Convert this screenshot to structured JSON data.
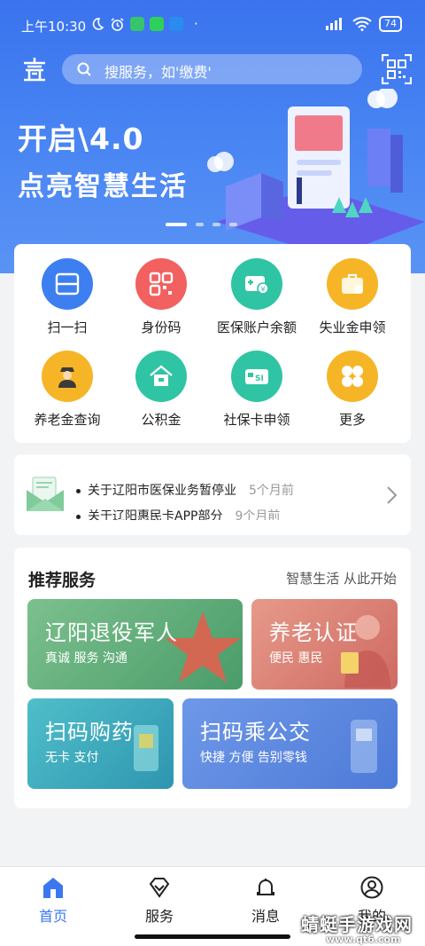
{
  "status_bar": {
    "time": "上午10:30",
    "battery": "74"
  },
  "search": {
    "placeholder": "搜服务，如'缴费'"
  },
  "banner": {
    "line1": "开启\\4.0",
    "line2": "点亮智慧生活"
  },
  "grid": [
    {
      "label": "扫一扫",
      "icon": "scan-icon",
      "color": "#3d7ff0"
    },
    {
      "label": "身份码",
      "icon": "id-qr-icon",
      "color": "#f26060"
    },
    {
      "label": "医保账户余额",
      "icon": "medical-card-icon",
      "color": "#2fc4a4"
    },
    {
      "label": "失业金申领",
      "icon": "unemployment-box-icon",
      "color": "#f6b526"
    },
    {
      "label": "养老金查询",
      "icon": "elder-person-icon",
      "color": "#f6b526"
    },
    {
      "label": "公积金",
      "icon": "house-icon",
      "color": "#2fc4a4"
    },
    {
      "label": "社保卡申领",
      "icon": "si-card-icon",
      "color": "#2fc4a4"
    },
    {
      "label": "更多",
      "icon": "more-icon",
      "color": "#f6b526"
    }
  ],
  "notices": [
    {
      "text": "关于辽阳市医保业务暂停业",
      "time": "5个月前"
    },
    {
      "text": "关于辽阳惠民卡APP部分",
      "time": "9个月前"
    }
  ],
  "recommend": {
    "title": "推荐服务",
    "subtitle": "智慧生活 从此开始",
    "tiles": [
      {
        "title": "辽阳退役军人",
        "sub": "真诚 服务 沟通"
      },
      {
        "title": "养老认证",
        "sub": "便民 惠民"
      },
      {
        "title": "扫码购药",
        "sub": "无卡 支付"
      },
      {
        "title": "扫码乘公交",
        "sub": "快捷 方便 告别零钱"
      }
    ]
  },
  "tabbar": [
    {
      "label": "首页"
    },
    {
      "label": "服务"
    },
    {
      "label": "消息"
    },
    {
      "label": "我的"
    }
  ],
  "watermark": {
    "title": "蜻蜓手游戏网",
    "url": "www.qt6.com"
  },
  "colors": {
    "primary": "#3b78ef",
    "green": "#2fc4a4",
    "red": "#f26060",
    "yellow": "#f6b526"
  }
}
